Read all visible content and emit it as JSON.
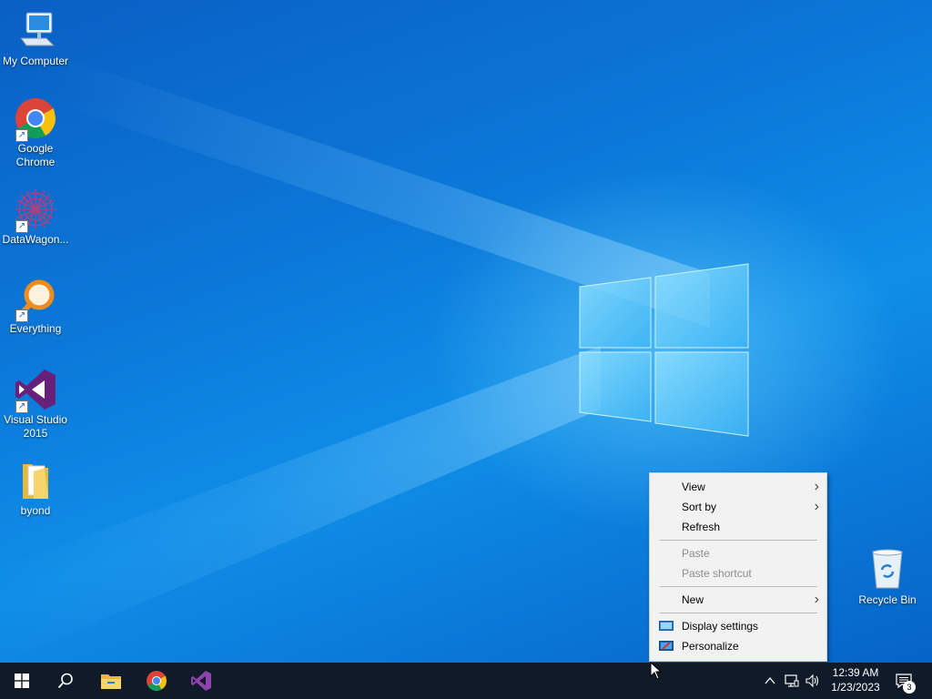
{
  "desktop_icons": [
    {
      "label": "My Computer",
      "icon": "computer-icon"
    },
    {
      "label": "Google\nChrome",
      "icon": "chrome-icon"
    },
    {
      "label": "DataWagon...",
      "icon": "datawagon-icon"
    },
    {
      "label": "Everything",
      "icon": "everything-search-icon"
    },
    {
      "label": "Visual Studio\n2015",
      "icon": "visual-studio-icon"
    },
    {
      "label": "byond",
      "icon": "folder-icon"
    },
    {
      "label": "Recycle Bin",
      "icon": "recycle-bin-icon"
    }
  ],
  "context_menu": {
    "items": [
      {
        "label": "View",
        "submenu": true,
        "enabled": true
      },
      {
        "label": "Sort by",
        "submenu": true,
        "enabled": true
      },
      {
        "label": "Refresh",
        "submenu": false,
        "enabled": true
      },
      {
        "label": "Paste",
        "submenu": false,
        "enabled": false
      },
      {
        "label": "Paste shortcut",
        "submenu": false,
        "enabled": false
      },
      {
        "label": "New",
        "submenu": true,
        "enabled": true
      },
      {
        "label": "Display settings",
        "submenu": false,
        "enabled": true,
        "icon": "display-settings-icon"
      },
      {
        "label": "Personalize",
        "submenu": false,
        "enabled": true,
        "icon": "personalize-icon"
      }
    ]
  },
  "taskbar": {
    "buttons": [
      {
        "name": "start",
        "icon": "windows-start-icon"
      },
      {
        "name": "search",
        "icon": "search-icon"
      },
      {
        "name": "file-explorer",
        "icon": "file-explorer-icon"
      },
      {
        "name": "chrome",
        "icon": "chrome-icon"
      },
      {
        "name": "visual-studio",
        "icon": "visual-studio-icon"
      }
    ],
    "tray": {
      "icons": [
        "chevron-up-icon",
        "network-icon",
        "volume-icon"
      ],
      "time": "12:39 AM",
      "date": "1/23/2023",
      "notification_count": "3"
    }
  },
  "colors": {
    "taskbar": "#101a28",
    "menu_bg": "#f2f2f2",
    "desktop_blue": "#0b77d8"
  }
}
